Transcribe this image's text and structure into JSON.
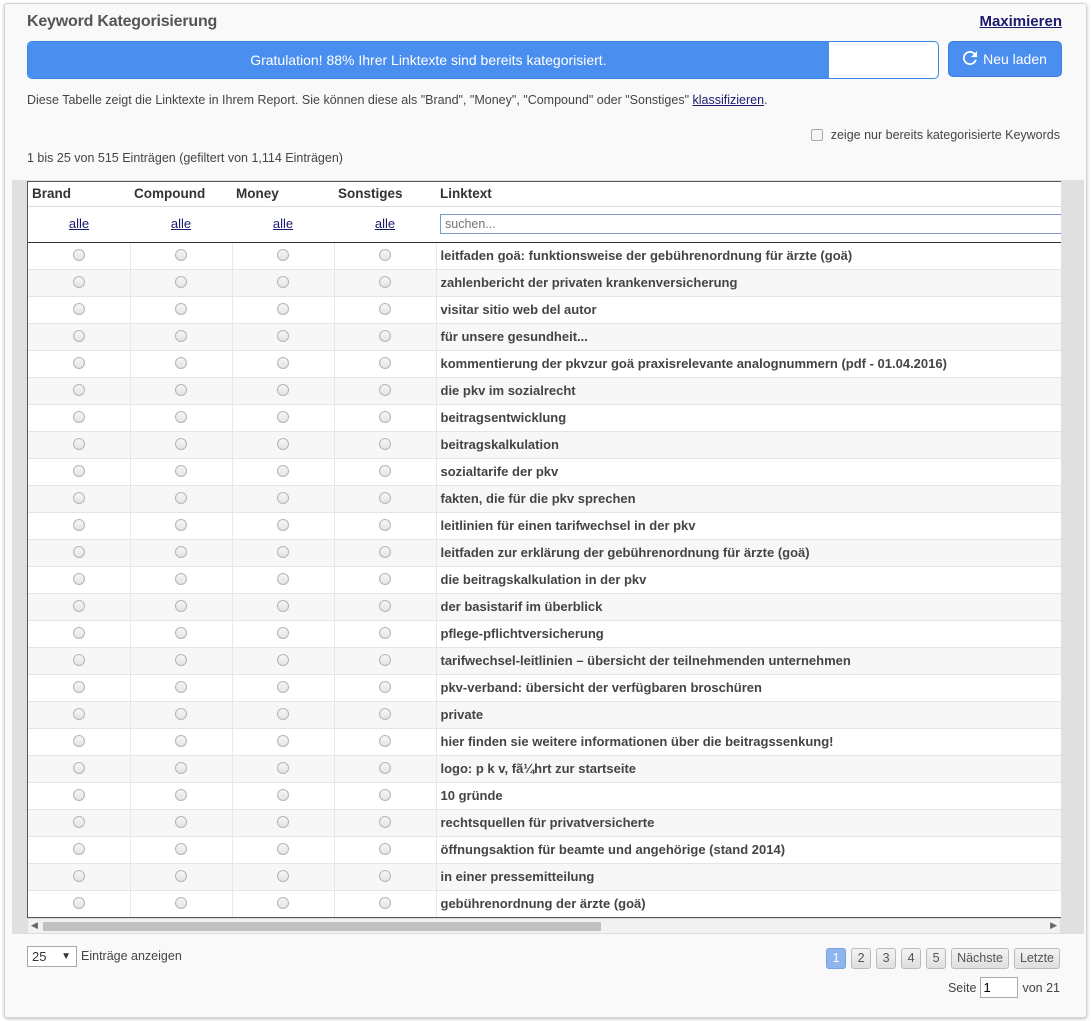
{
  "header": {
    "title": "Keyword Kategorisierung",
    "maximize_label": "Maximieren"
  },
  "progress": {
    "text": "Gratulation! 88% Ihrer Linktexte sind bereits kategorisiert.",
    "percent": 88
  },
  "reload_label": "Neu laden",
  "description": {
    "text": "Diese Tabelle zeigt die Linktexte in Ihrem Report. Sie können diese als \"Brand\", \"Money\", \"Compound\" oder \"Sonstiges\" ",
    "link": "klassifizieren",
    "suffix": "."
  },
  "filter_checkbox_label": "zeige nur bereits kategorisierte Keywords",
  "info": "1 bis 25 von 515 Einträgen (gefiltert von 1,114 Einträgen)",
  "columns": [
    "Brand",
    "Compound",
    "Money",
    "Sonstiges",
    "Linktext"
  ],
  "filter_all_label": "alle",
  "search_placeholder": "suchen...",
  "rows": [
    "leitfaden goä: funktionsweise der gebührenordnung für ärzte (goä)",
    "zahlenbericht der privaten krankenversicherung",
    "visitar sitio web del autor",
    "für unsere gesundheit...",
    "kommentierung der pkvzur goä praxisrelevante analognummern (pdf - 01.04.2016)",
    "die pkv im sozialrecht",
    "beitragsentwicklung",
    "beitragskalkulation",
    "sozialtarife der pkv",
    "fakten, die für die pkv sprechen",
    "leitlinien für einen tarifwechsel in der pkv",
    "leitfaden zur erklärung der gebührenordnung für ärzte (goä)",
    "die beitragskalkulation in der pkv",
    "der basistarif im überblick",
    "pflege-pflichtversicherung",
    "tarifwechsel-leitlinien – übersicht der teilnehmenden unternehmen",
    "pkv-verband: übersicht der verfügbaren broschüren",
    "private",
    "hier finden sie weitere informationen über die beitragssenkung!",
    "logo: p k v, fã¼hrt zur startseite",
    "10 gründe",
    "rechtsquellen für privatversicherte",
    "öffnungsaktion für beamte und angehörige (stand 2014)",
    "in einer pressemitteilung",
    "gebührenordnung der ärzte (goä)"
  ],
  "length": {
    "value": "25",
    "label": "Einträge anzeigen"
  },
  "pagination": {
    "pages": [
      "1",
      "2",
      "3",
      "4",
      "5"
    ],
    "next": "Nächste",
    "last": "Letzte",
    "current": "1"
  },
  "page_jump": {
    "prefix": "Seite",
    "value": "1",
    "suffix": "von 21"
  },
  "colors": {
    "accent": "#4a8ff0",
    "link": "#1a1a6e",
    "active_page": "#8fb5ef"
  }
}
